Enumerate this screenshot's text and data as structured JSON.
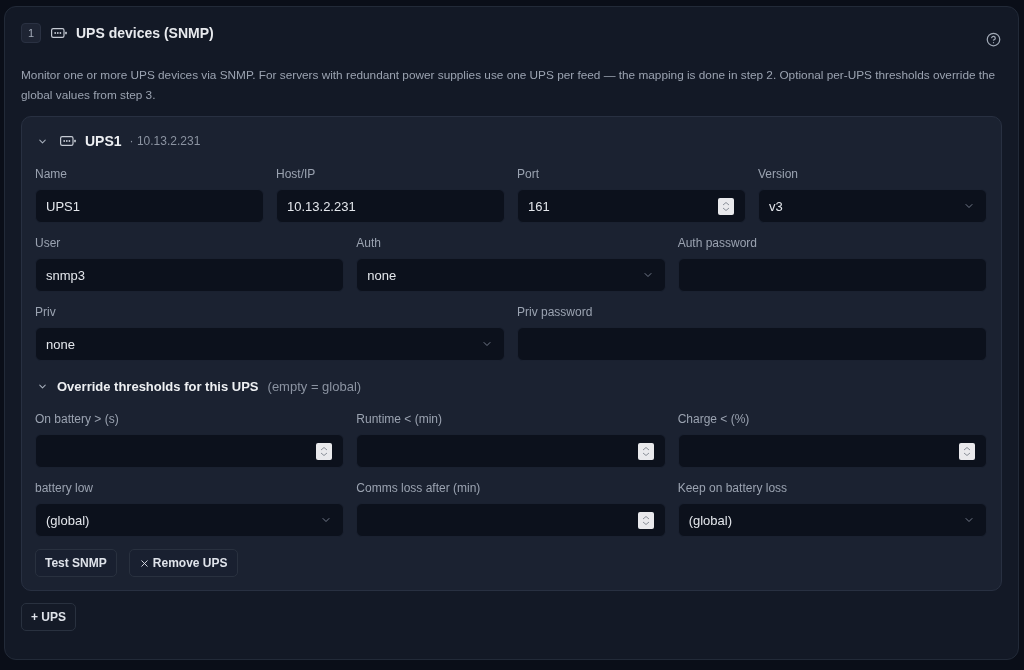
{
  "section": {
    "step": "1",
    "title": "UPS devices (SNMP)",
    "description": "Monitor one or more UPS devices via SNMP. For servers with redundant power supplies use one UPS per feed — the mapping is done in step 2. Optional per-UPS thresholds override the global values from step 3."
  },
  "ups_list": [
    {
      "name": "UPS1",
      "address": "· 10.13.2.231",
      "expanded": true,
      "rows": [
        [
          {
            "label": "Name",
            "kind": "text",
            "value": "UPS1"
          },
          {
            "label": "Host/IP",
            "kind": "text",
            "value": "10.13.2.231"
          },
          {
            "label": "Port",
            "kind": "number",
            "value": "161"
          },
          {
            "label": "Version",
            "kind": "select",
            "value": "v3"
          }
        ],
        [
          {
            "label": "User",
            "kind": "text",
            "value": "snmp3"
          },
          {
            "label": "Auth",
            "kind": "select",
            "value": "none"
          },
          {
            "label": "Auth password",
            "kind": "password"
          }
        ],
        [
          {
            "label": "Priv",
            "kind": "select",
            "value": "none"
          },
          {
            "label": "Priv password",
            "kind": "password"
          }
        ]
      ],
      "overrides": {
        "title": "Override thresholds for this UPS",
        "hint": "(empty = global)",
        "expanded": true,
        "rows": [
          [
            {
              "label": "On battery > (s)",
              "kind": "number"
            },
            {
              "label": "Runtime < (min)",
              "kind": "number"
            },
            {
              "label": "Charge < (%)",
              "kind": "number"
            }
          ],
          [
            {
              "label": "battery low",
              "kind": "select",
              "value": "(global)"
            },
            {
              "label": "Comms loss after (min)",
              "kind": "number"
            },
            {
              "label": "Keep on battery loss",
              "kind": "select",
              "value": "(global)"
            }
          ]
        ]
      },
      "buttons": [
        {
          "label": "Test SNMP",
          "kind": "plain"
        },
        {
          "label": "Remove UPS",
          "kind": "remove"
        }
      ]
    }
  ],
  "add_button": {
    "label": "+ UPS"
  }
}
